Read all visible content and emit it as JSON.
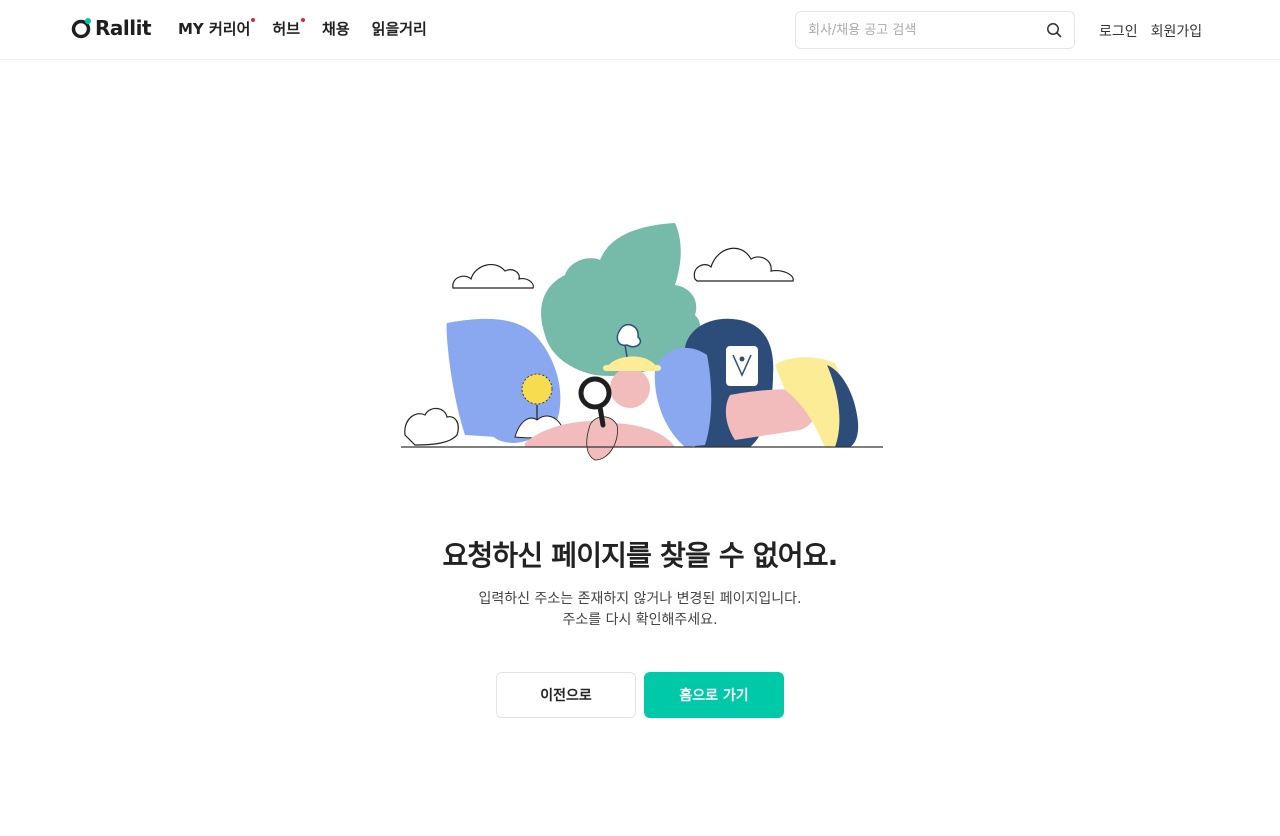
{
  "header": {
    "logo_text": "Rallit",
    "nav": [
      {
        "label": "MY 커리어",
        "has_dot": true
      },
      {
        "label": "허브",
        "has_dot": true
      },
      {
        "label": "채용",
        "has_dot": false
      },
      {
        "label": "읽을거리",
        "has_dot": false
      }
    ],
    "search_placeholder": "회사/채용 공고 검색",
    "login_label": "로그인",
    "signup_label": "회원가입"
  },
  "error": {
    "title": "요청하신 페이지를 찾을 수 없어요.",
    "desc_line1": "입력하신 주소는 존재하지 않거나 변경된 페이지입니다.",
    "desc_line2": "주소를 다시 확인해주세요."
  },
  "buttons": {
    "prev_label": "이전으로",
    "home_label": "홈으로 가기"
  },
  "colors": {
    "accent": "#00c9a7",
    "nav_dot": "#e5252a"
  }
}
